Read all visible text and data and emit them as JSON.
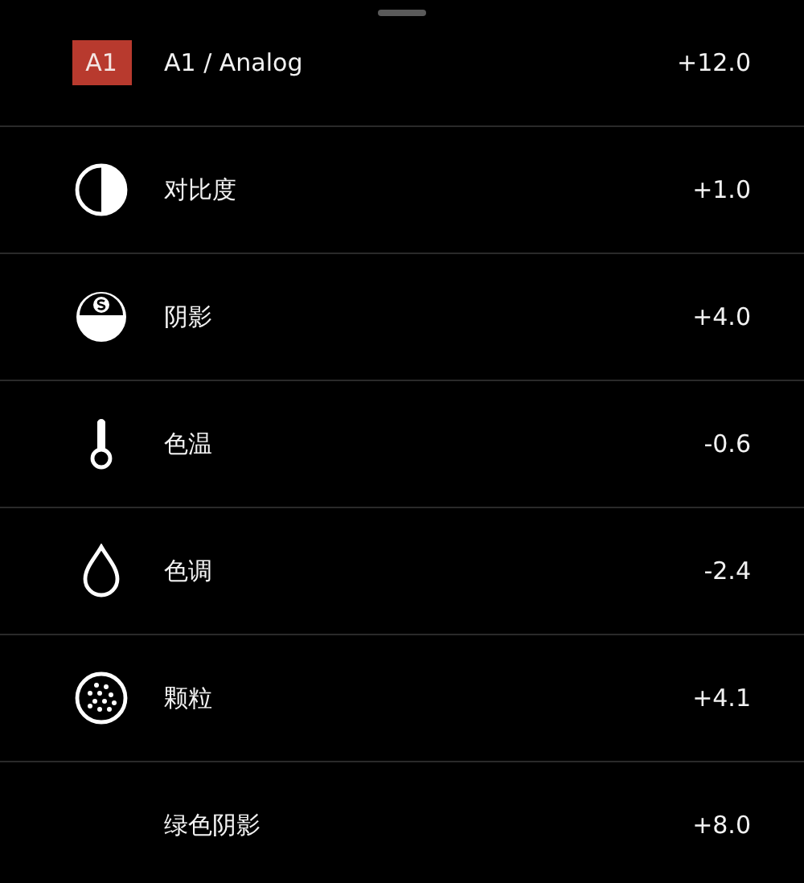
{
  "adjustments": [
    {
      "kind": "badge",
      "badge": "A1",
      "label": "A1 / Analog",
      "value": "+12.0"
    },
    {
      "kind": "contrast",
      "label": "对比度",
      "value": "+1.0"
    },
    {
      "kind": "shadow",
      "label": "阴影",
      "value": "+4.0"
    },
    {
      "kind": "temperature",
      "label": "色温",
      "value": "-0.6"
    },
    {
      "kind": "tint",
      "label": "色调",
      "value": "-2.4"
    },
    {
      "kind": "grain",
      "label": "颗粒",
      "value": "+4.1"
    },
    {
      "kind": "plain",
      "label": "绿色阴影",
      "value": "+8.0"
    }
  ]
}
